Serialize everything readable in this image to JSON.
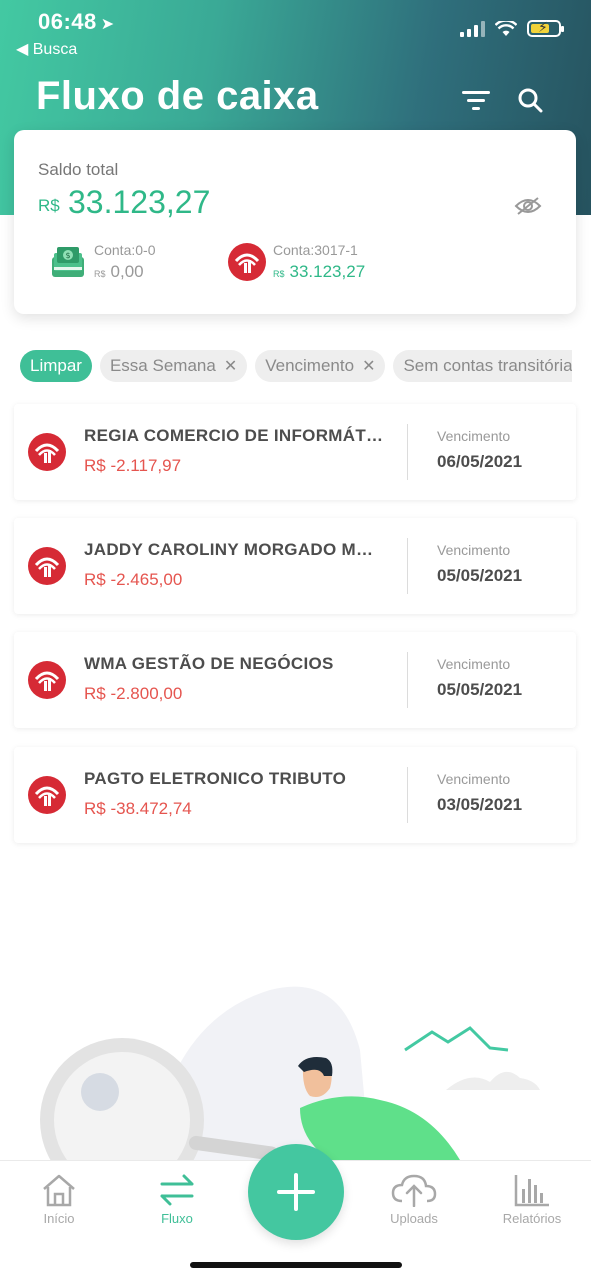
{
  "status": {
    "time": "06:48",
    "back_label": "◀ Busca"
  },
  "header": {
    "title": "Fluxo de caixa",
    "icons": [
      "filter-icon",
      "search-icon"
    ]
  },
  "balance": {
    "label": "Saldo total",
    "currency": "R$",
    "value": "33.123,27",
    "accounts": [
      {
        "name": "Conta:0-0",
        "currency": "R$",
        "value": "0,00",
        "icon": "cash-icon"
      },
      {
        "name": "Conta:3017-1",
        "currency": "R$",
        "value": "33.123,27",
        "icon": "bank-logo-icon"
      }
    ]
  },
  "filters": [
    {
      "label": "Limpar",
      "active": true
    },
    {
      "label": "Essa Semana",
      "removable": true
    },
    {
      "label": "Vencimento",
      "removable": true
    },
    {
      "label": "Sem contas transitórias",
      "removable": true
    }
  ],
  "transactions": [
    {
      "name": "REGIA COMERCIO DE INFORMÁTICA",
      "amount": "R$ -2.117,97",
      "due_label": "Vencimento",
      "due_date": "06/05/2021"
    },
    {
      "name": "JADDY CAROLINY MORGADO MARTINS",
      "amount": "R$ -2.465,00",
      "due_label": "Vencimento",
      "due_date": "05/05/2021"
    },
    {
      "name": "WMA GESTÃO DE NEGÓCIOS",
      "amount": "R$ -2.800,00",
      "due_label": "Vencimento",
      "due_date": "05/05/2021"
    },
    {
      "name": "PAGTO ELETRONICO TRIBUTO",
      "amount": "R$ -38.472,74",
      "due_label": "Vencimento",
      "due_date": "03/05/2021"
    }
  ],
  "tabbar": {
    "items": [
      {
        "label": "Início",
        "icon": "home-icon"
      },
      {
        "label": "Fluxo",
        "icon": "transfer-arrows-icon",
        "active": true
      },
      {
        "label": "Uploads",
        "icon": "cloud-upload-icon"
      },
      {
        "label": "Relatórios",
        "icon": "bar-chart-icon"
      }
    ],
    "fab_icon": "plus-icon"
  },
  "colors": {
    "accent": "#3fbf97",
    "negative": "#e5554f",
    "header_dark": "#26535f"
  }
}
